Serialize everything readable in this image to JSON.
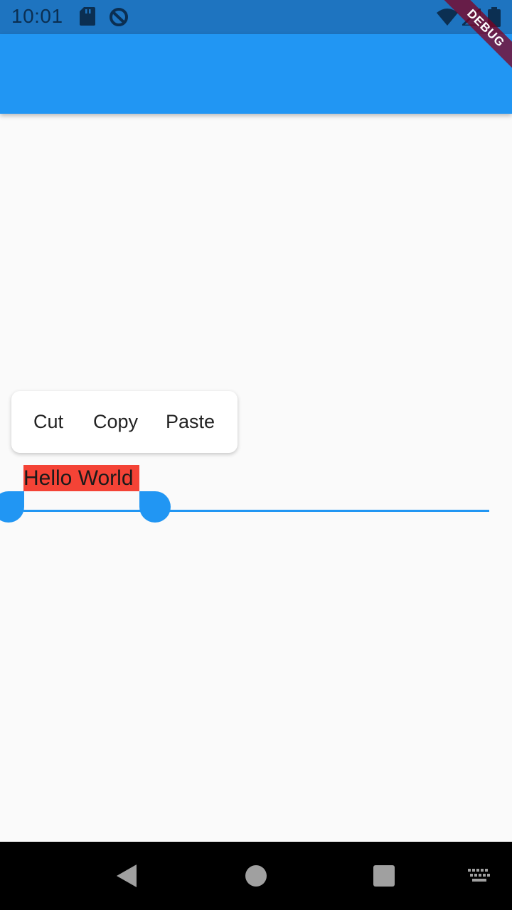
{
  "status_bar": {
    "time": "10:01",
    "left_icons": [
      "sd-card-icon",
      "sync-disabled-icon"
    ],
    "right_icons": [
      "wifi-icon",
      "signal-icon",
      "battery-icon"
    ]
  },
  "debug_banner": {
    "label": "DEBUG"
  },
  "app_bar": {
    "title": "",
    "color": "#2196F3"
  },
  "text_toolbar": {
    "cut_label": "Cut",
    "copy_label": "Copy",
    "paste_label": "Paste"
  },
  "text_field": {
    "value": "Hello World",
    "selection_color": "#F44336",
    "accent_color": "#2196F3"
  },
  "nav_bar": {
    "icons": [
      "back-icon",
      "home-icon",
      "recents-icon",
      "keyboard-icon"
    ]
  }
}
